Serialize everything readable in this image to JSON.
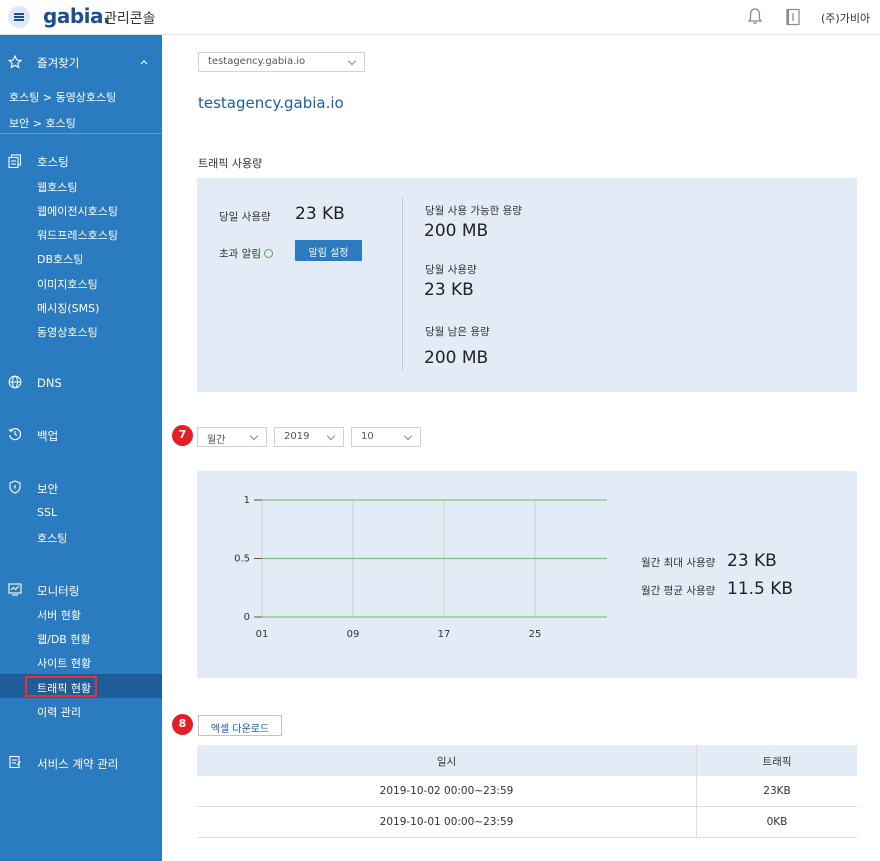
{
  "header": {
    "logo": "gabia.",
    "console_label": "관리콘솔",
    "company": "(주)가비아"
  },
  "sidebar": {
    "favorites": {
      "label": "즐겨찾기",
      "items": [
        "호스팅 > 동영상호스팅",
        "보안 > 호스팅"
      ]
    },
    "hosting": {
      "label": "호스팅",
      "items": [
        "웹호스팅",
        "웹에이전시호스팅",
        "워드프레스호스팅",
        "DB호스팅",
        "이미지호스팅",
        "메시징(SMS)",
        "동영상호스팅"
      ]
    },
    "dns": {
      "label": "DNS"
    },
    "backup": {
      "label": "백업"
    },
    "security": {
      "label": "보안",
      "items": [
        "SSL",
        "호스팅"
      ]
    },
    "monitoring": {
      "label": "모니터링",
      "items": [
        "서버 현황",
        "웹/DB 현황",
        "사이트 현황",
        "트래픽 현황",
        "이력 관리"
      ],
      "active": "트래픽 현황"
    },
    "contract": {
      "label": "서비스 계약 관리"
    }
  },
  "main": {
    "domain_select": "testagency.gabia.io",
    "domain_title": "testagency.gabia.io",
    "section_title": "트래픽 사용량",
    "summary": {
      "today_label": "당일 사용량",
      "today_value": "23 KB",
      "alert_label": "초과 알림",
      "alert_button": "알림 설정",
      "available_label": "당월 사용 가능한 용량",
      "available_value": "200 MB",
      "month_used_label": "당월 사용량",
      "month_used_value": "23 KB",
      "remaining_label": "당월 남은 용량",
      "remaining_value": "200 MB"
    },
    "filters": {
      "period": "월간",
      "year": "2019",
      "month": "10"
    },
    "badges": {
      "filter": "7",
      "excel": "8"
    },
    "stats": {
      "max_label": "월간 최대 사용량",
      "max_value": "23 KB",
      "avg_label": "월간 평균 사용량",
      "avg_value": "11.5 KB"
    },
    "excel_button": "엑셀 다운로드",
    "table": {
      "headers": [
        "일시",
        "트래픽"
      ],
      "rows": [
        [
          "2019-10-02 00:00~23:59",
          "23KB"
        ],
        [
          "2019-10-01 00:00~23:59",
          "0KB"
        ]
      ]
    }
  },
  "chart_data": {
    "type": "line",
    "x_tick_labels": [
      "01",
      "09",
      "17",
      "25"
    ],
    "y_tick_labels": [
      "1",
      "0.5",
      "0"
    ],
    "ylim": [
      0,
      1
    ],
    "grid": true,
    "series": []
  },
  "colors": {
    "sidebar": "#2a7bc0",
    "sidebar_active": "#1f5d9a",
    "panel": "#e3ecf6",
    "accent": "#1a5fa8",
    "badge": "#e41e26",
    "gridline": "#7cc576"
  }
}
